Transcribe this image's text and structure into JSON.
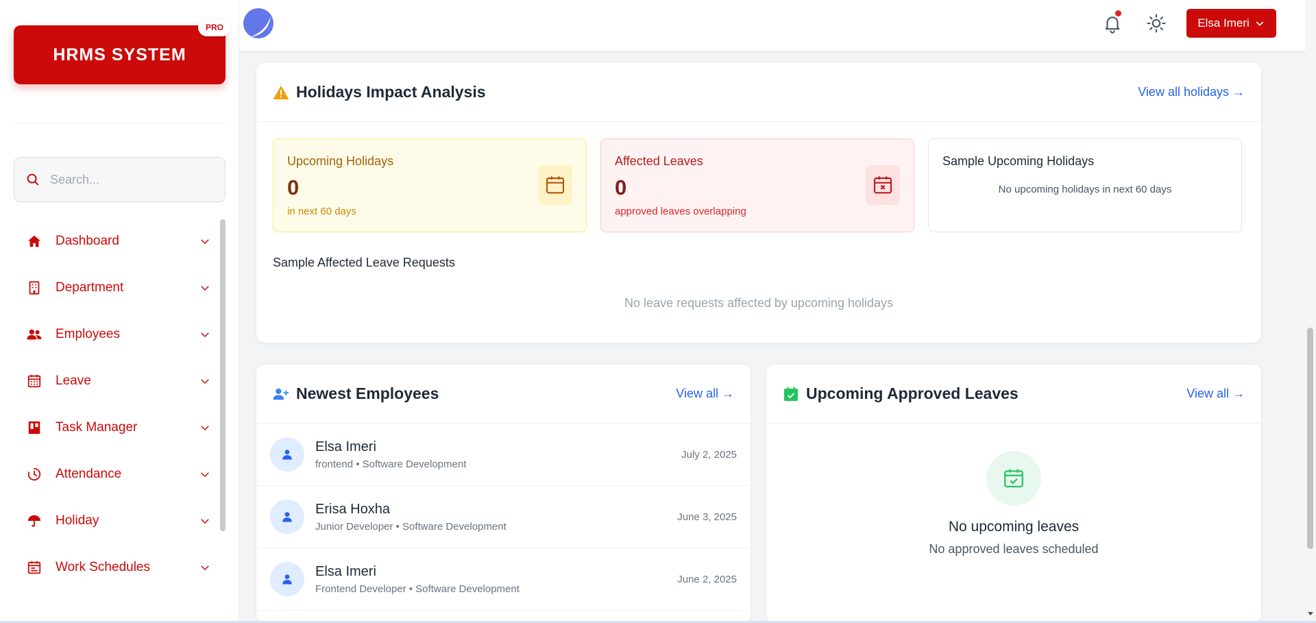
{
  "sidebar": {
    "brand": "HRMS SYSTEM",
    "badge": "PRO",
    "search_placeholder": "Search...",
    "items": [
      {
        "label": "Dashboard",
        "icon": "home-icon"
      },
      {
        "label": "Department",
        "icon": "building-icon"
      },
      {
        "label": "Employees",
        "icon": "users-icon"
      },
      {
        "label": "Leave",
        "icon": "calendar-grid-icon"
      },
      {
        "label": "Task Manager",
        "icon": "kanban-icon"
      },
      {
        "label": "Attendance",
        "icon": "clock-icon"
      },
      {
        "label": "Holiday",
        "icon": "umbrella-icon"
      },
      {
        "label": "Work Schedules",
        "icon": "schedule-icon"
      }
    ]
  },
  "header": {
    "user_name": "Elsa Imeri",
    "has_notification": true
  },
  "impact": {
    "title": "Holidays Impact Analysis",
    "view_all": "View all holidays →",
    "upcoming": {
      "label": "Upcoming Holidays",
      "value": "0",
      "sub": "in next 60 days"
    },
    "affected": {
      "label": "Affected Leaves",
      "value": "0",
      "sub": "approved leaves overlapping"
    },
    "sample_upcoming": {
      "title": "Sample Upcoming Holidays",
      "empty": "No upcoming holidays in next 60 days"
    },
    "sample_affected": {
      "title": "Sample Affected Leave Requests",
      "empty": "No leave requests affected by upcoming holidays"
    }
  },
  "newest": {
    "title": "Newest Employees",
    "view_all": "View all →",
    "employees": [
      {
        "name": "Elsa Imeri",
        "meta": "frontend • Software Development",
        "date": "July 2, 2025"
      },
      {
        "name": "Erisa Hoxha",
        "meta": "Junior Developer • Software Development",
        "date": "June 3, 2025"
      },
      {
        "name": "Elsa Imeri",
        "meta": "Frontend Developer • Software Development",
        "date": "June 2, 2025"
      }
    ]
  },
  "upcoming_leaves": {
    "title": "Upcoming Approved Leaves",
    "view_all": "View all →",
    "empty_title": "No upcoming leaves",
    "empty_sub": "No approved leaves scheduled"
  },
  "colors": {
    "brand_red": "#cc0a0a",
    "link_blue": "#2563eb",
    "warning_amber": "#f59e0b",
    "success_green": "#22c55e"
  }
}
